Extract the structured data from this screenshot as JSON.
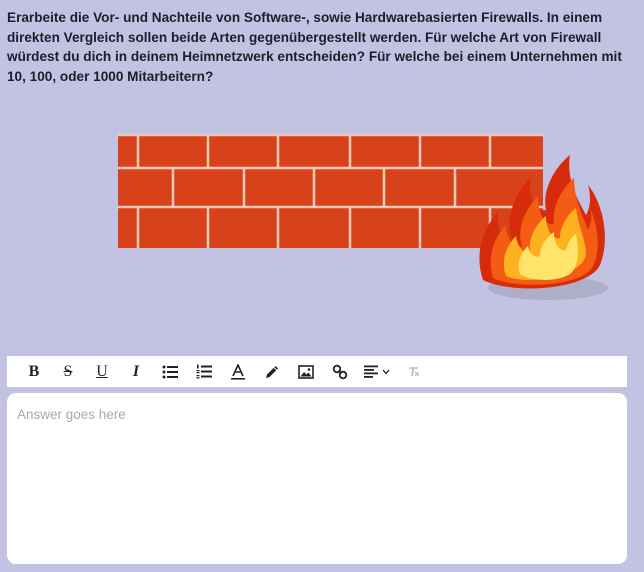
{
  "question": {
    "text": "Erarbeite die Vor- und Nachteile von Software-, sowie Hardwarebasierten Firewalls. In einem direkten Vergleich sollen beide Arten gegenübergestellt werden. Für welche Art von Firewall würdest du dich in deinem Heimnetzwerk entscheiden? Für welche bei einem Unternehmen mit 10, 100, oder 1000 Mitarbeitern?"
  },
  "illustration": {
    "name": "firewall-illustration",
    "brick_color": "#d7421a",
    "mortar_color": "#f0c9b8",
    "flame_colors": [
      "#ffe36b",
      "#ffb21f",
      "#f45b13",
      "#d62c0b"
    ]
  },
  "toolbar": {
    "bold_label": "B",
    "strikethrough_label": "S",
    "underline_label": "U",
    "italic_label": "I",
    "tools": [
      "bold",
      "strikethrough",
      "underline",
      "italic",
      "bullet-list",
      "numbered-list",
      "text-color",
      "highlight",
      "image",
      "link",
      "align",
      "clear-format"
    ]
  },
  "answer": {
    "placeholder": "Answer goes here",
    "value": ""
  }
}
